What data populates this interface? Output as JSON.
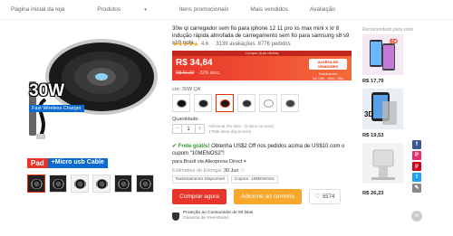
{
  "nav": {
    "items": [
      "Página inicial da loja",
      "Produtos",
      "Itens promocionais",
      "Mais vendidos",
      "Avaliação"
    ]
  },
  "gallery": {
    "badge_30w": "30W",
    "badge_fast": "Fast Wireless Charger",
    "badge_pad": "Pad",
    "badge_cable": "+Micro usb Cable"
  },
  "product": {
    "title": "30w qi carregador sem fio para iphone 12 11 pro xs max mini x xr 8 indução rápida almofada de carregamento sem fio para samsung s8 s9 s10 nota",
    "rating_value": "4.6",
    "reviews": "3139 avaliações",
    "orders": "8776 pedidos",
    "stars": "★★★★★"
  },
  "price": {
    "banner": "Compre já as ofertas",
    "current": "R$ 34,84",
    "original": "R$ 51,23",
    "discount": "-32% desc.",
    "flash_tag": "ALERTA DE VENDORES",
    "flash_ends": "Termina em",
    "flash_time": "1d: 05h : 40m : 30s"
  },
  "options": {
    "color_label": "cor: 30W QA",
    "quantity_label": "Quantidade:",
    "quantity_value": "1",
    "availability_1": "Adicional 3% desc. (5 itens ou mais)",
    "availability_2": "17886 itens disponíveis"
  },
  "shipping": {
    "title_ok": "Frete grátis!",
    "title_rest": "Obtenha US$2 Off nos pedidos acima de US$10 com o cupom \"10MENOS2\"!",
    "to": "para Brazil via Aliexpress Direct",
    "est_label": "Estimativa de Entrega:",
    "est_date": "30 Jun",
    "tag1": "Rastreamento Disponível",
    "tag2": "Cupom: 10MENOS2"
  },
  "actions": {
    "buy": "Comprar agora",
    "cart": "Adicione ao carrinho",
    "wishlist_count": "5574"
  },
  "protection": {
    "line1": "Proteção ao Consumidor de 90 Dias",
    "line2": "Garantia de Reembolso"
  },
  "recommended": {
    "title": "Recomendado para você",
    "prices": [
      "R$ 17,79",
      "R$ 19,53",
      "R$ 26,23"
    ],
    "label_3d": "3D"
  },
  "colors": {
    "accent": "#e62e04",
    "buy": "#e8352b",
    "cart": "#f7a72b"
  }
}
